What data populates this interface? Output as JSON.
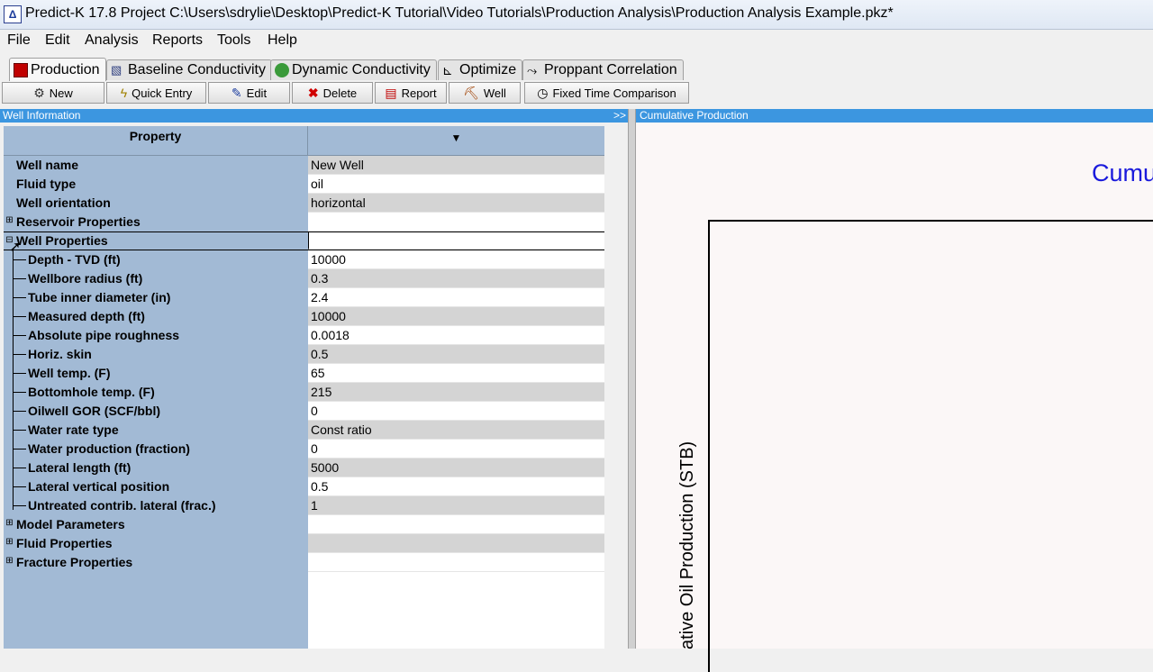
{
  "window": {
    "title": "Predict-K 17.8 Project C:\\Users\\sdrylie\\Desktop\\Predict-K Tutorial\\Video Tutorials\\Production Analysis\\Production Analysis Example.pkz*"
  },
  "menu": [
    "File",
    "Edit",
    "Analysis",
    "Reports",
    "Tools",
    "Help"
  ],
  "tabs": [
    {
      "label": "Production",
      "icon": "production-icon",
      "active": true
    },
    {
      "label": "Baseline Conductivity",
      "icon": "baseline-icon",
      "active": false
    },
    {
      "label": "Dynamic Conductivity",
      "icon": "globe-icon",
      "active": false
    },
    {
      "label": "Optimize",
      "icon": "optimize-icon",
      "active": false
    },
    {
      "label": "Proppant Correlation",
      "icon": "proppant-icon",
      "active": false
    }
  ],
  "toolbar": {
    "new": "New",
    "quick_entry": "Quick Entry",
    "edit": "Edit",
    "delete": "Delete",
    "report": "Report",
    "well": "Well",
    "fixed_time": "Fixed Time Comparison"
  },
  "left_panel": {
    "title": "Well Information",
    "collapse": ">>",
    "col_property": "Property",
    "col_value_symbol": "▼"
  },
  "rows": [
    {
      "label": "Well name",
      "value": "New Well"
    },
    {
      "label": "Fluid type",
      "value": "oil"
    },
    {
      "label": "Well orientation",
      "value": "horizontal"
    },
    {
      "label": "Reservoir Properties",
      "value": ""
    },
    {
      "label": "Well Properties",
      "value": ""
    },
    {
      "label": "Depth - TVD (ft)",
      "value": "10000"
    },
    {
      "label": "Wellbore radius (ft)",
      "value": "0.3"
    },
    {
      "label": "Tube inner diameter (in)",
      "value": "2.4"
    },
    {
      "label": "Measured depth (ft)",
      "value": "10000"
    },
    {
      "label": "Absolute pipe roughness",
      "value": "0.0018"
    },
    {
      "label": "Horiz. skin",
      "value": "0.5"
    },
    {
      "label": "Well temp. (F)",
      "value": "65"
    },
    {
      "label": "Bottomhole temp. (F)",
      "value": "215"
    },
    {
      "label": "Oilwell GOR (SCF/bbl)",
      "value": "0"
    },
    {
      "label": "Water rate type",
      "value": "Const ratio"
    },
    {
      "label": "Water production (fraction)",
      "value": "0"
    },
    {
      "label": "Lateral length (ft)",
      "value": "5000"
    },
    {
      "label": "Lateral vertical position",
      "value": "0.5"
    },
    {
      "label": "Untreated contrib. lateral (frac.)",
      "value": "1"
    },
    {
      "label": "Model Parameters",
      "value": ""
    },
    {
      "label": "Fluid Properties",
      "value": ""
    },
    {
      "label": "Fracture Properties",
      "value": ""
    }
  ],
  "right_panel": {
    "title": "Cumulative Production",
    "chart_title": "Cumu",
    "ylabel": "ative Oil Production (STB)"
  }
}
